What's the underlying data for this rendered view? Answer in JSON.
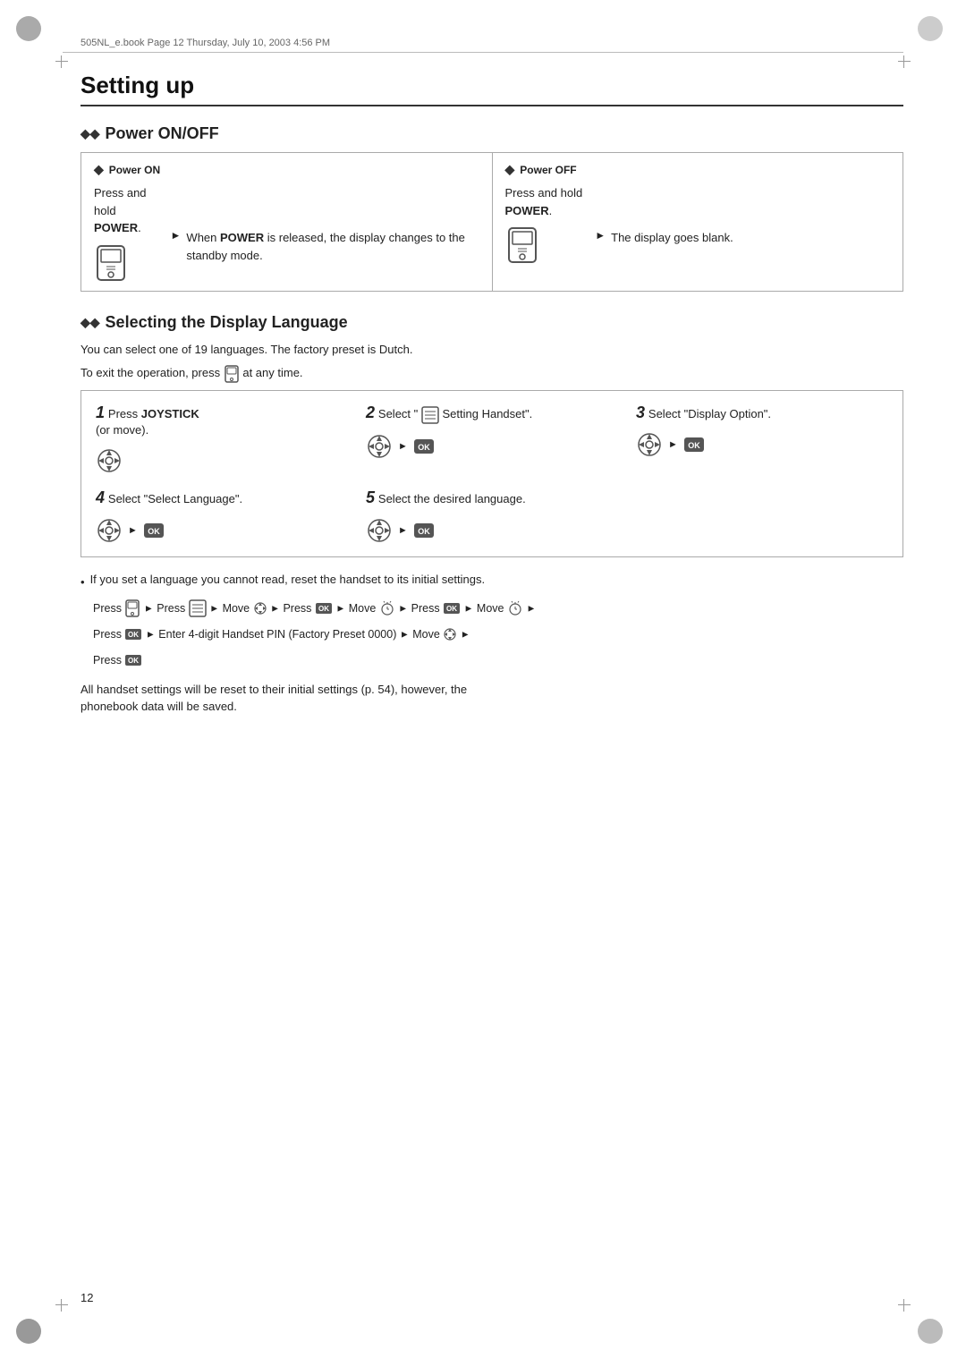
{
  "file_info": "505NL_e.book  Page 12  Thursday, July 10, 2003  4:56 PM",
  "page_title": "Setting up",
  "power_section": {
    "title": "Power ON/OFF",
    "power_on": {
      "subtitle": "Power ON",
      "step1": "Press and hold POWER.",
      "step2_intro": "When ",
      "step2_bold": "POWER",
      "step2_rest": " is released, the display changes to the standby mode."
    },
    "power_off": {
      "subtitle": "Power OFF",
      "step1": "Press and hold POWER.",
      "step2": "The display goes blank."
    }
  },
  "lang_section": {
    "title": "Selecting the Display Language",
    "desc1": "You can select one of 19 languages. The factory preset is Dutch.",
    "desc2": "To exit the operation, press",
    "desc2_end": "at any time.",
    "steps": [
      {
        "num": "1",
        "label": "Press JOYSTICK (or move)."
      },
      {
        "num": "2",
        "label": "Select “ Setting Handset”."
      },
      {
        "num": "3",
        "label": "Select “Display Option”."
      },
      {
        "num": "4",
        "label": "Select “Select Language”."
      },
      {
        "num": "5",
        "label": "Select the desired language."
      }
    ]
  },
  "reset_note": "If you set a language you cannot read, reset the handset to its initial settings.",
  "reset_sequence": "Press ▶ Press ▶ Move ▶ Press ▶ Move ▶ Press ▶ Move ▶ Press ▶ Enter 4-digit Handset PIN (Factory Preset 0000) ▶ Move ▶ Press",
  "all_reset_note1": "All handset settings will be reset to their initial settings (p. 54), however, the",
  "all_reset_note2": "phonebook data will be saved.",
  "page_number": "12"
}
